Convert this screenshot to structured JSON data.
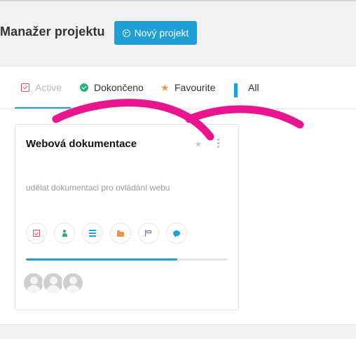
{
  "header": {
    "title": "Manažer projektu",
    "new_button_label": "Nový projekt"
  },
  "tabs": [
    {
      "label": "Active",
      "icon": "checkbox-icon",
      "active": true
    },
    {
      "label": "Dokončeno",
      "icon": "check-circle-icon",
      "active": false
    },
    {
      "label": "Favourite",
      "icon": "star-icon",
      "active": false
    },
    {
      "label": "All",
      "icon": "grid-icon",
      "active": false
    }
  ],
  "project_card": {
    "title": "Webová dokumentace",
    "description": "udělat dokumentaci pro ovládání webu",
    "progress_fraction": 0.75,
    "action_icons": [
      "task-checkbox-icon",
      "members-icon",
      "list-icon",
      "folder-icon",
      "flag-icon",
      "chat-icon"
    ],
    "avatars_count": 3
  },
  "colors": {
    "accent": "#1f9fd6",
    "annotation": "#e8158f"
  }
}
